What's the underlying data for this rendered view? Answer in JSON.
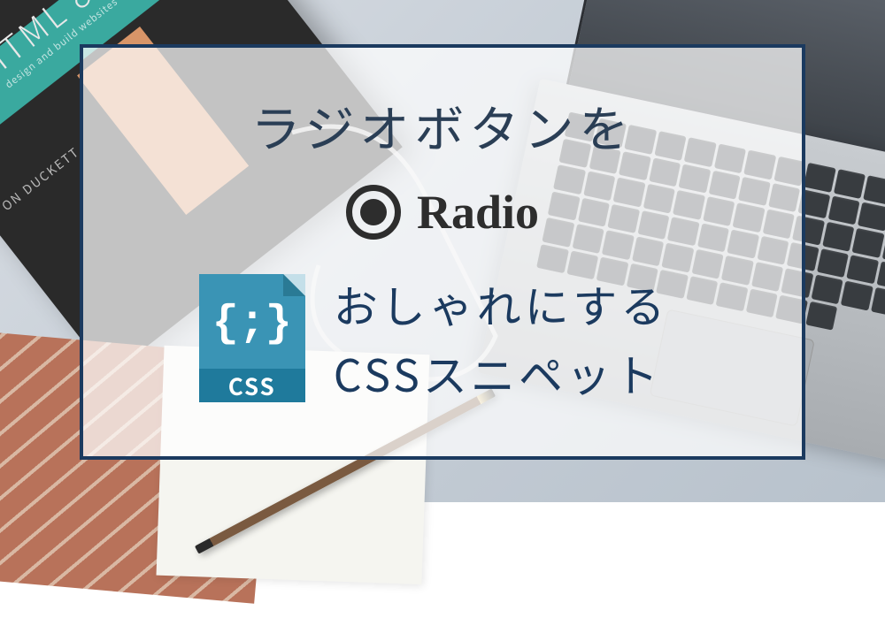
{
  "card": {
    "title_line1": "ラジオボタンを",
    "radio_label": "Radio",
    "title_line2": "おしゃれにする",
    "title_line3": "CSSスニペット"
  },
  "css_icon": {
    "braces": "{;}",
    "label": "CSS"
  },
  "book": {
    "title": "HTML &CSS",
    "subtitle": "design and build websites",
    "author": "ON DUCKETT"
  },
  "colors": {
    "border": "#1b3a5f",
    "text_dark": "#2a3e55",
    "css_icon": "#3a94b5"
  }
}
